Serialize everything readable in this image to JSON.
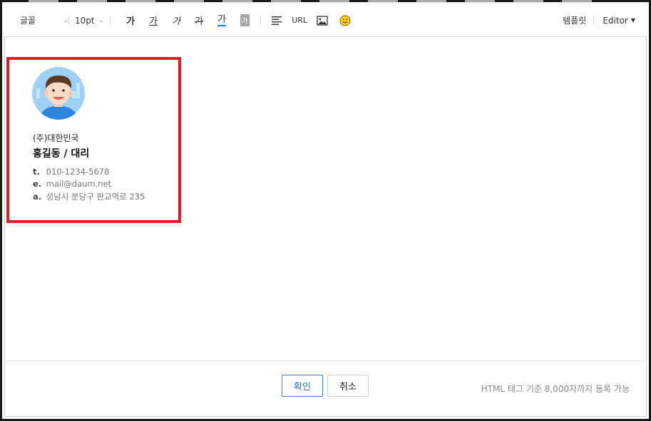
{
  "toolbar": {
    "font_label": "글꼴",
    "size_label": "10pt",
    "format": {
      "bold": "가",
      "underline": "가",
      "italic": "가",
      "strike": "가",
      "color": "가",
      "background": "가"
    },
    "align_icon": "align-left-icon",
    "url_label": "URL",
    "image_icon": "image-icon",
    "emoji_icon": "smiley-icon",
    "template_label": "템플릿",
    "editor_label": "Editor"
  },
  "signature": {
    "company": "(주)대한민국",
    "name_title": "홍길동 / 대리",
    "tel_key": "t.",
    "tel": "010-1234-5678",
    "email_key": "e.",
    "email": "mail@daum.net",
    "addr_key": "a.",
    "address": "성남시 분당구 판교역로 235"
  },
  "footer": {
    "confirm_label": "확인",
    "cancel_label": "취소",
    "limit_text": "HTML 태그 기준 8,000자까지 등록 가능"
  },
  "colors": {
    "highlight_border": "#e01b22",
    "confirm_accent": "#1f6fd1",
    "text_color_underline": "#1a7ef2"
  }
}
